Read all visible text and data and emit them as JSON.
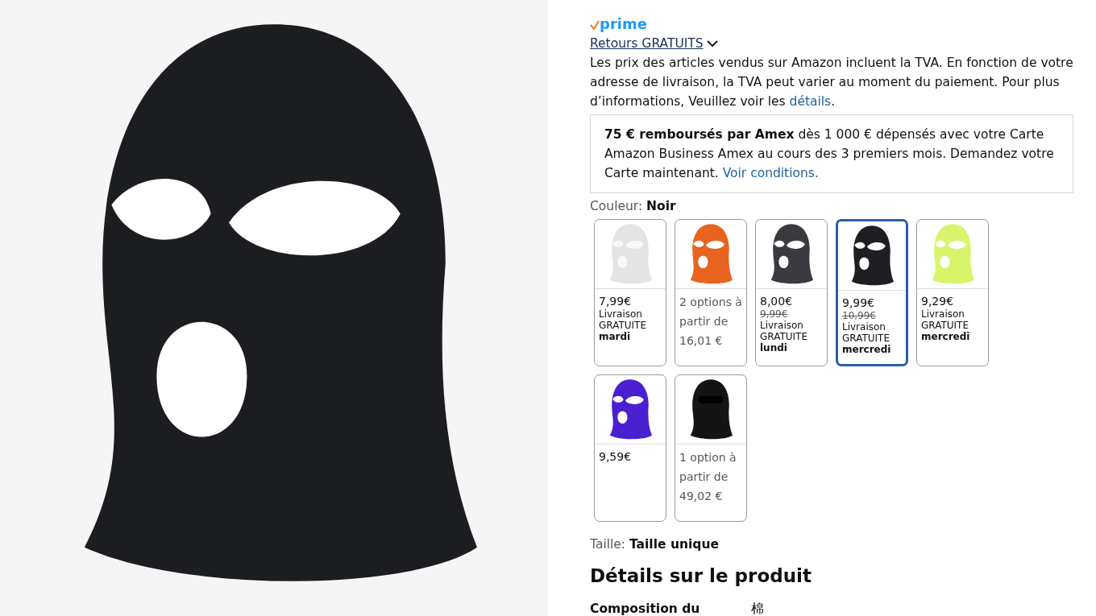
{
  "product_image": {
    "color": "#1c1d20"
  },
  "prime": {
    "label": "prime"
  },
  "returns": {
    "label": "Retours GRATUITS",
    "expanded": false
  },
  "tax_note": {
    "text": "Les prix des articles vendus sur Amazon incluent la TVA. En fonction de votre adresse de livraison, la TVA peut varier au moment du paiement. Pour plus d’informations, Veuillez voir les",
    "link": "détails",
    "end": "."
  },
  "amex_offer": {
    "text": "**75 € remboursés par Amex** dès 1 000 € dépensés avec votre Carte Amazon Business Amex au cours des 3 premiers mois. Demandez votre Carte maintenant.",
    "link": "Voir conditions."
  },
  "color_label": {
    "label": "Couleur:",
    "value": "Noir"
  },
  "swatches": [
    {
      "kind": "price",
      "color": "#e4e4e4",
      "selected": false,
      "price": "7,99€",
      "delivery": "Livraison GRATUITE **mardi**"
    },
    {
      "kind": "options",
      "color": "#e8641e",
      "selected": false,
      "text": "2 options à partir de 16,01 €"
    },
    {
      "kind": "price",
      "color": "#3a3b40",
      "selected": false,
      "price": "8,00€",
      "list_price": "9,99€",
      "delivery": "Livraison GRATUITE **lundi**"
    },
    {
      "kind": "price",
      "color": "#1e1f23",
      "selected": true,
      "price": "9,99€",
      "list_price": "10,99€",
      "delivery": "Livraison GRATUITE **mercredi**"
    },
    {
      "kind": "price",
      "color": "#d8f46a",
      "selected": false,
      "price": "9,29€",
      "delivery": "Livraison GRATUITE **mercredi**"
    },
    {
      "kind": "price",
      "color": "#4a1fd0",
      "selected": false,
      "price": "9,59€"
    },
    {
      "kind": "options",
      "color": "#141414",
      "selected": false,
      "text": "1 option à partir de 49,02 €"
    }
  ],
  "size_label": {
    "label": "Taille:",
    "value": "Taille unique"
  },
  "details_heading": "Détails sur le produit",
  "details": [
    {
      "label": "Composition du",
      "value": "棉"
    }
  ]
}
